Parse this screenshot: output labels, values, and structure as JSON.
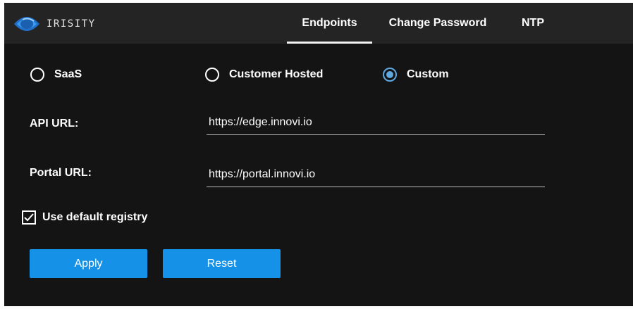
{
  "header": {
    "logo_text": "IRISITY",
    "tabs": [
      {
        "label": "Endpoints",
        "active": true
      },
      {
        "label": "Change Password",
        "active": false
      },
      {
        "label": "NTP",
        "active": false
      }
    ]
  },
  "endpoint_options": [
    {
      "label": "SaaS",
      "selected": false
    },
    {
      "label": "Customer Hosted",
      "selected": false
    },
    {
      "label": "Custom",
      "selected": true
    }
  ],
  "form": {
    "api_url_label": "API URL:",
    "api_url_value": "https://edge.innovi.io",
    "portal_url_label": "Portal URL:",
    "portal_url_value": "https://portal.innovi.io",
    "use_default_registry_label": "Use default registry",
    "use_default_registry_checked": true
  },
  "buttons": {
    "apply_label": "Apply",
    "reset_label": "Reset"
  },
  "colors": {
    "background": "#141414",
    "header": "#242424",
    "accent": "#1592e8",
    "radio_selected": "#5fa8e0"
  }
}
